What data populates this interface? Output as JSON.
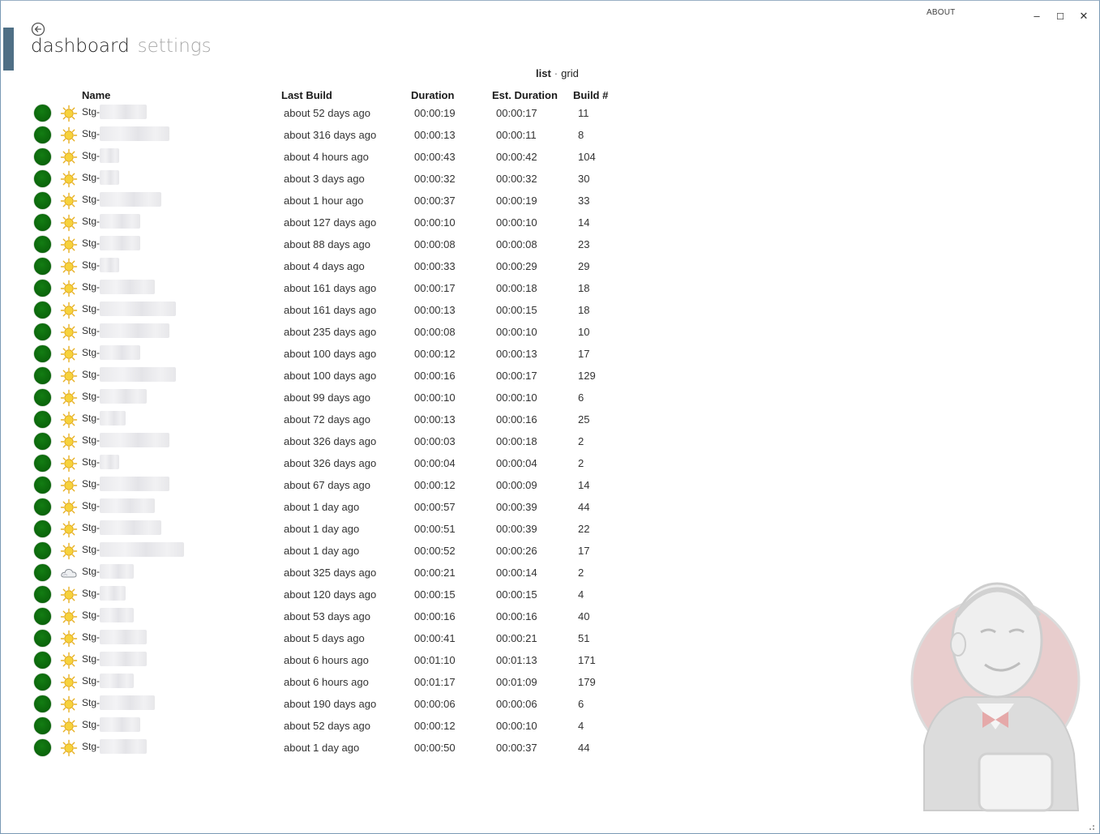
{
  "window": {
    "about_label": "ABOUT",
    "minimize_glyph": "–",
    "maximize_glyph": "☐",
    "close_glyph": "✕"
  },
  "nav": {
    "back_icon": "back-arrow-circle-icon",
    "tabs": [
      {
        "label": "dashboard",
        "active": true
      },
      {
        "label": "settings",
        "active": false
      }
    ]
  },
  "view_toggle": {
    "list_label": "list",
    "separator": "·",
    "grid_label": "grid",
    "selected": "list"
  },
  "table": {
    "headers": {
      "name": "Name",
      "last_build": "Last Build",
      "duration": "Duration",
      "est_duration": "Est. Duration",
      "build_number": "Build #"
    },
    "rows": [
      {
        "weather": "sunny",
        "name": "Stg-",
        "last_build": "about 52 days ago",
        "duration": "00:00:19",
        "est_duration": "00:00:17",
        "build": "11"
      },
      {
        "weather": "sunny",
        "name": "Stg-",
        "last_build": "about 316 days ago",
        "duration": "00:00:13",
        "est_duration": "00:00:11",
        "build": "8"
      },
      {
        "weather": "sunny",
        "name": "Stg-",
        "last_build": "about 4 hours ago",
        "duration": "00:00:43",
        "est_duration": "00:00:42",
        "build": "104"
      },
      {
        "weather": "sunny",
        "name": "Stg-",
        "last_build": "about 3 days ago",
        "duration": "00:00:32",
        "est_duration": "00:00:32",
        "build": "30"
      },
      {
        "weather": "sunny",
        "name": "Stg-",
        "last_build": "about 1 hour ago",
        "duration": "00:00:37",
        "est_duration": "00:00:19",
        "build": "33"
      },
      {
        "weather": "sunny",
        "name": "Stg-",
        "last_build": "about 127 days ago",
        "duration": "00:00:10",
        "est_duration": "00:00:10",
        "build": "14"
      },
      {
        "weather": "sunny",
        "name": "Stg-",
        "last_build": "about 88 days ago",
        "duration": "00:00:08",
        "est_duration": "00:00:08",
        "build": "23"
      },
      {
        "weather": "sunny",
        "name": "Stg-",
        "last_build": "about 4 days ago",
        "duration": "00:00:33",
        "est_duration": "00:00:29",
        "build": "29"
      },
      {
        "weather": "sunny",
        "name": "Stg-",
        "last_build": "about 161 days ago",
        "duration": "00:00:17",
        "est_duration": "00:00:18",
        "build": "18"
      },
      {
        "weather": "sunny",
        "name": "Stg-",
        "last_build": "about 161 days ago",
        "duration": "00:00:13",
        "est_duration": "00:00:15",
        "build": "18"
      },
      {
        "weather": "sunny",
        "name": "Stg-",
        "last_build": "about 235 days ago",
        "duration": "00:00:08",
        "est_duration": "00:00:10",
        "build": "10"
      },
      {
        "weather": "sunny",
        "name": "Stg-",
        "last_build": "about 100 days ago",
        "duration": "00:00:12",
        "est_duration": "00:00:13",
        "build": "17"
      },
      {
        "weather": "sunny",
        "name": "Stg-",
        "last_build": "about 100 days ago",
        "duration": "00:00:16",
        "est_duration": "00:00:17",
        "build": "129"
      },
      {
        "weather": "sunny",
        "name": "Stg-",
        "last_build": "about 99 days ago",
        "duration": "00:00:10",
        "est_duration": "00:00:10",
        "build": "6"
      },
      {
        "weather": "sunny",
        "name": "Stg-",
        "last_build": "about 72 days ago",
        "duration": "00:00:13",
        "est_duration": "00:00:16",
        "build": "25"
      },
      {
        "weather": "sunny",
        "name": "Stg-",
        "last_build": "about 326 days ago",
        "duration": "00:00:03",
        "est_duration": "00:00:18",
        "build": "2"
      },
      {
        "weather": "sunny",
        "name": "Stg-",
        "last_build": "about 326 days ago",
        "duration": "00:00:04",
        "est_duration": "00:00:04",
        "build": "2"
      },
      {
        "weather": "sunny",
        "name": "Stg-",
        "last_build": "about 67 days ago",
        "duration": "00:00:12",
        "est_duration": "00:00:09",
        "build": "14"
      },
      {
        "weather": "sunny",
        "name": "Stg-",
        "last_build": "about 1 day ago",
        "duration": "00:00:57",
        "est_duration": "00:00:39",
        "build": "44"
      },
      {
        "weather": "sunny",
        "name": "Stg-",
        "last_build": "about 1 day ago",
        "duration": "00:00:51",
        "est_duration": "00:00:39",
        "build": "22"
      },
      {
        "weather": "sunny",
        "name": "Stg-",
        "last_build": "about 1 day ago",
        "duration": "00:00:52",
        "est_duration": "00:00:26",
        "build": "17"
      },
      {
        "weather": "cloudy",
        "name": "Stg-",
        "last_build": "about 325 days ago",
        "duration": "00:00:21",
        "est_duration": "00:00:14",
        "build": "2"
      },
      {
        "weather": "sunny",
        "name": "Stg-",
        "last_build": "about 120 days ago",
        "duration": "00:00:15",
        "est_duration": "00:00:15",
        "build": "4"
      },
      {
        "weather": "sunny",
        "name": "Stg-",
        "last_build": "about 53 days ago",
        "duration": "00:00:16",
        "est_duration": "00:00:16",
        "build": "40"
      },
      {
        "weather": "sunny",
        "name": "Stg-",
        "last_build": "about 5 days ago",
        "duration": "00:00:41",
        "est_duration": "00:00:21",
        "build": "51"
      },
      {
        "weather": "sunny",
        "name": "Stg-",
        "last_build": "about 6 hours ago",
        "duration": "00:01:10",
        "est_duration": "00:01:13",
        "build": "171"
      },
      {
        "weather": "sunny",
        "name": "Stg-",
        "last_build": "about 6 hours ago",
        "duration": "00:01:17",
        "est_duration": "00:01:09",
        "build": "179"
      },
      {
        "weather": "sunny",
        "name": "Stg-",
        "last_build": "about 190 days ago",
        "duration": "00:00:06",
        "est_duration": "00:00:06",
        "build": "6"
      },
      {
        "weather": "sunny",
        "name": "Stg-",
        "last_build": "about 52 days ago",
        "duration": "00:00:12",
        "est_duration": "00:00:10",
        "build": "4"
      },
      {
        "weather": "sunny",
        "name": "Stg-",
        "last_build": "about 1 day ago",
        "duration": "00:00:50",
        "est_duration": "00:00:37",
        "build": "44"
      }
    ]
  },
  "colors": {
    "status_success": "#0b640b",
    "accent": "#4f6f85",
    "inactive_tab": "#a8a8a8"
  }
}
